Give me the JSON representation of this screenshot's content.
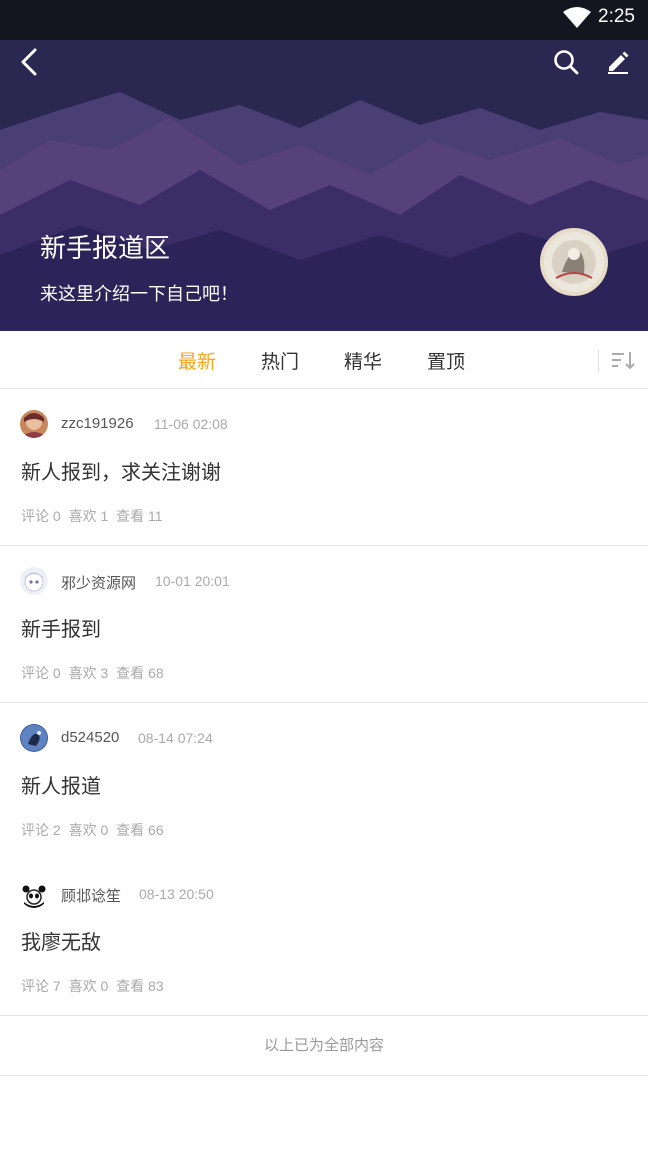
{
  "status_bar": {
    "time": "2:25",
    "wifi_icon": "wifi-icon"
  },
  "header": {
    "back_icon": "chevron-left-icon",
    "search_icon": "search-icon",
    "edit_icon": "pencil-icon",
    "title": "新手报道区",
    "subtitle": "来这里介绍一下自己吧！"
  },
  "tabs": {
    "items": [
      {
        "label": "最新",
        "active": true
      },
      {
        "label": "热门",
        "active": false
      },
      {
        "label": "精华",
        "active": false
      },
      {
        "label": "置顶",
        "active": false
      }
    ],
    "sort_icon": "sort-descending-icon",
    "active_color": "#f5a623"
  },
  "posts": [
    {
      "author": "zzc191926",
      "time": "11-06 02:08",
      "title": "新人报到，求关注谢谢",
      "comments_label": "评论 0",
      "likes_label": "喜欢 1",
      "views_label": "查看 11"
    },
    {
      "author": "邪少资源网",
      "time": "10-01 20:01",
      "title": "新手报到",
      "comments_label": "评论 0",
      "likes_label": "喜欢 3",
      "views_label": "查看 68"
    },
    {
      "author": "d524520",
      "time": "08-14 07:24",
      "title": "新人报道",
      "comments_label": "评论 2",
      "likes_label": "喜欢 0",
      "views_label": "查看 66"
    },
    {
      "author": "顾邶谂笙",
      "time": "08-13 20:50",
      "title": "我廖无敌",
      "comments_label": "评论 7",
      "likes_label": "喜欢 0",
      "views_label": "查看 83"
    }
  ],
  "footer_note": "以上已为全部内容"
}
